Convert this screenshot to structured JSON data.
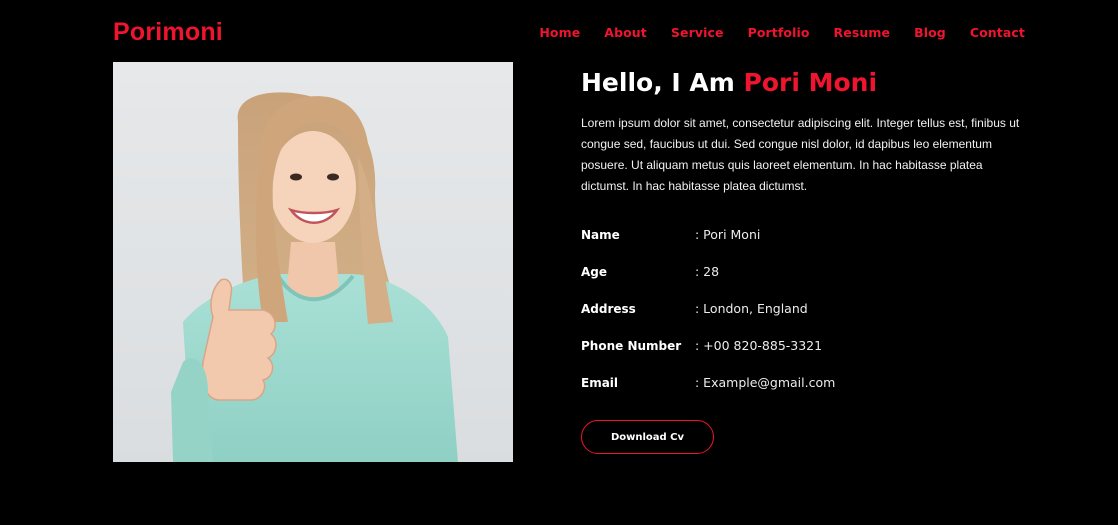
{
  "brand": {
    "logo": "Porimoni",
    "accent_color": "#f0142f",
    "background_color": "#000000"
  },
  "nav": {
    "items": [
      {
        "label": "Home"
      },
      {
        "label": "About"
      },
      {
        "label": "Service"
      },
      {
        "label": "Portfolio"
      },
      {
        "label": "Resume"
      },
      {
        "label": "Blog"
      },
      {
        "label": "Contact"
      }
    ]
  },
  "about": {
    "photo_icon": "portrait-photo",
    "title_prefix": "Hello, I Am",
    "title_name": "Pori Moni",
    "intro": "Lorem ipsum dolor sit amet, consectetur adipiscing elit. Integer tellus est, finibus ut congue sed, faucibus ut dui. Sed congue nisl dolor, id dapibus leo elementum posuere. Ut aliquam metus quis laoreet elementum. In hac habitasse platea dictumst. In hac habitasse platea dictumst.",
    "info": [
      {
        "label": "Name",
        "value": ": Pori Moni"
      },
      {
        "label": "Age",
        "value": ": 28"
      },
      {
        "label": "Address",
        "value": ": London, England"
      },
      {
        "label": "Phone Number",
        "value": ": +00 820-885-3321"
      },
      {
        "label": "Email",
        "value": ": Example@gmail.com"
      }
    ],
    "cv_button": "Download Cv"
  }
}
